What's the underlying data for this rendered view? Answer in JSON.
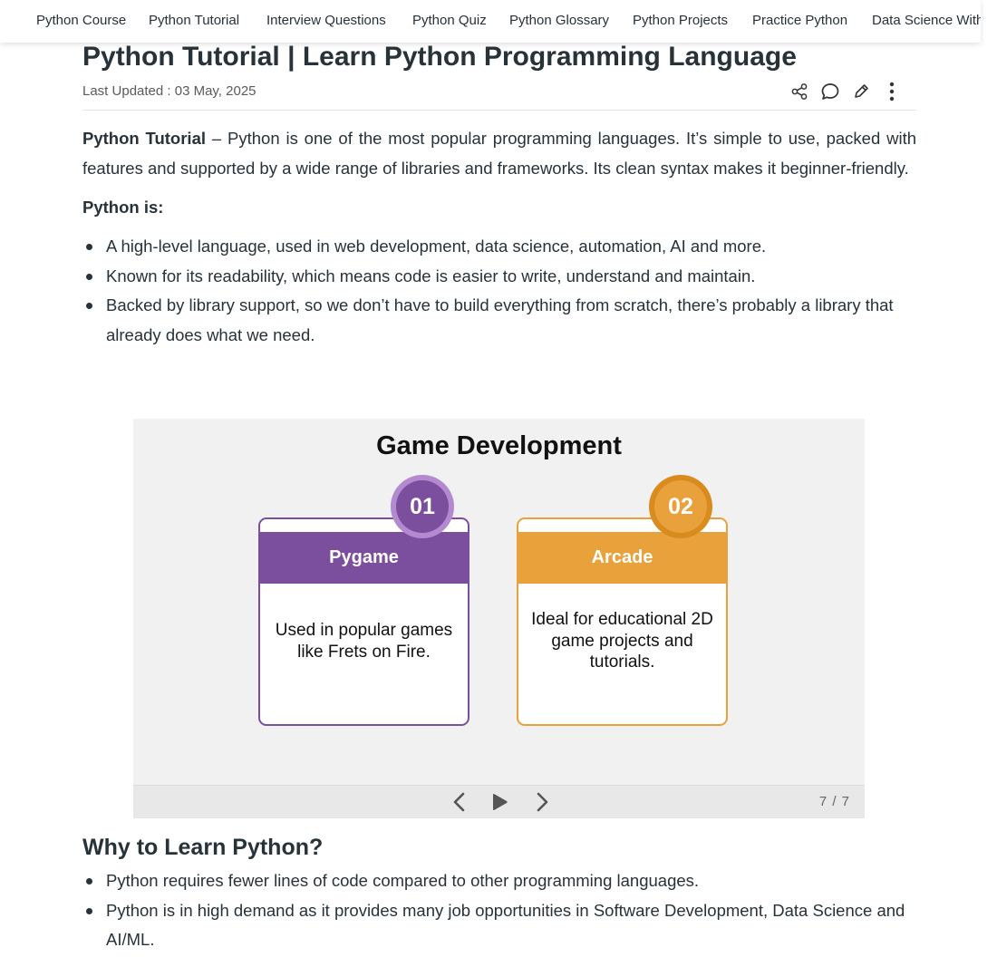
{
  "nav": {
    "items": [
      "Python Course",
      "Python Tutorial",
      "Interview Questions",
      "Python Quiz",
      "Python Glossary",
      "Python Projects",
      "Practice Python",
      "Data Science With Python"
    ]
  },
  "article": {
    "title": "Python Tutorial | Learn Python Programming Language",
    "last_updated": "Last Updated : 03 May, 2025",
    "actions": [
      "share-icon",
      "comment-icon",
      "edit-icon",
      "more-vertical-icon"
    ],
    "intro_bold": "Python Tutorial",
    "intro_rest": " – Python is one of the most popular programming languages. It’s simple to use, packed with features and supported by a wide range of libraries and frameworks. Its clean syntax makes it beginner-friendly.",
    "subhead": "Python is:",
    "bullets": [
      "A high-level language, used in web development, data science, automation, AI and more.",
      "Known for its readability, which means code is easier to write, understand and maintain.",
      "Backed by library support, so we don’t have to build everything from scratch, there’s probably a library that already does what we need."
    ]
  },
  "slideshow": {
    "title": "Game Development",
    "cards": [
      {
        "number": "01",
        "name": "Pygame",
        "description": "Used in popular games like Frets on Fire.",
        "color": "#7b4f9e",
        "ring_color": "#b38ad0"
      },
      {
        "number": "02",
        "name": "Arcade",
        "description": "Ideal for educational 2D game projects and tutorials.",
        "color": "#e9a13b",
        "ring_color": "#d98b1e"
      }
    ],
    "counter": "7 / 7",
    "controls": [
      "chevron-left-icon",
      "play-icon",
      "chevron-right-icon"
    ]
  },
  "why": {
    "heading": "Why to Learn Python?",
    "bullets": [
      "Python requires fewer lines of code compared to other programming languages.",
      "Python is in high demand as it provides many job opportunities in Software Development, Data Science and AI/ML."
    ]
  }
}
